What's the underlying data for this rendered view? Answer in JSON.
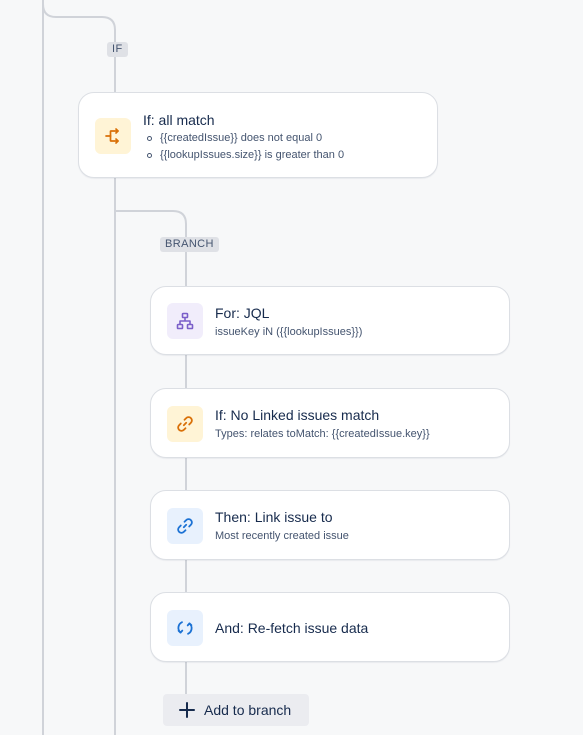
{
  "colors": {
    "background": "#f7f8f9",
    "connector": "#d0d3d9",
    "tag_background": "#dfe1e6",
    "condition_icon_bg": "#fff4d6",
    "condition_icon": "#d97008",
    "branch_icon_bg": "#f1edfb",
    "branch_icon": "#7b5fc9",
    "action_icon_bg": "#e8f1fd",
    "action_icon": "#1c72d4"
  },
  "if_tag": "IF",
  "if_card": {
    "icon": "branch-split-icon",
    "title": "If: all match",
    "conditions": [
      "{{createdIssue}} does not equal 0",
      "{{lookupIssues.size}} is greater than 0"
    ]
  },
  "branch_tag": "BRANCH",
  "branch_items": [
    {
      "icon": "hierarchy-icon",
      "title": "For: JQL",
      "subtitle": "issueKey iN ({{lookupIssues}})"
    },
    {
      "icon": "link-icon",
      "title": "If: No Linked issues match",
      "subtitle": "Types: relates toMatch: {{createdIssue.key}}"
    },
    {
      "icon": "link-icon",
      "title": "Then: Link issue to",
      "subtitle": "Most recently created issue"
    },
    {
      "icon": "refresh-icon",
      "title": "And: Re-fetch issue data",
      "subtitle": ""
    }
  ],
  "add_button": {
    "icon": "plus-icon",
    "label": "Add to branch"
  }
}
